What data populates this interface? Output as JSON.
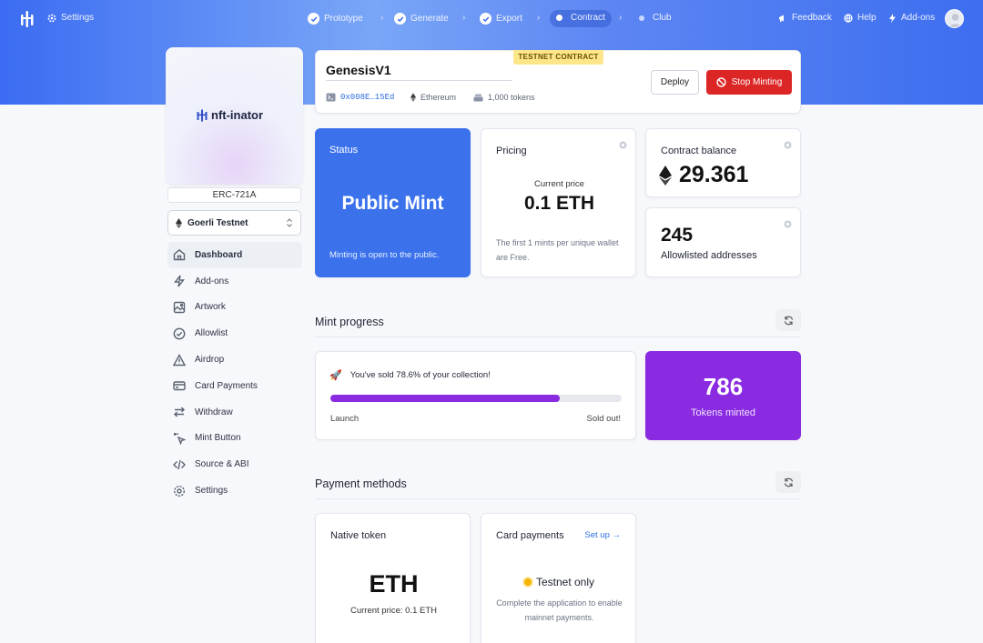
{
  "topbar": {
    "settings_label": "Settings",
    "steps": [
      {
        "label": "Prototype",
        "state": "done"
      },
      {
        "label": "Generate",
        "state": "done"
      },
      {
        "label": "Export",
        "state": "done"
      },
      {
        "label": "Contract",
        "state": "active"
      },
      {
        "label": "Club",
        "state": "pending"
      }
    ],
    "feedback_label": "Feedback",
    "help_label": "Help",
    "addons_label": "Add-ons"
  },
  "sidebar": {
    "brand": "nft-inator",
    "token_standard": "ERC-721A",
    "network": "Goerli Testnet",
    "items": [
      {
        "label": "Dashboard",
        "icon": "home-icon",
        "active": true
      },
      {
        "label": "Add-ons",
        "icon": "lightning-icon"
      },
      {
        "label": "Artwork",
        "icon": "image-icon"
      },
      {
        "label": "Allowlist",
        "icon": "check-circle-icon"
      },
      {
        "label": "Airdrop",
        "icon": "warning-triangle-icon"
      },
      {
        "label": "Card Payments",
        "icon": "credit-card-icon"
      },
      {
        "label": "Withdraw",
        "icon": "arrows-swap-icon"
      },
      {
        "label": "Mint Button",
        "icon": "cursor-click-icon"
      },
      {
        "label": "Source & ABI",
        "icon": "code-icon"
      },
      {
        "label": "Settings",
        "icon": "gear-icon"
      }
    ]
  },
  "contract": {
    "name": "GenesisV1",
    "badge": "TESTNET CONTRACT",
    "address": "0x008E…15Ed",
    "chain": "Ethereum",
    "supply": "1,000 tokens",
    "deploy_label": "Deploy",
    "stop_label": "Stop Minting"
  },
  "status": {
    "label": "Status",
    "value": "Public Mint",
    "note": "Minting is open to the public."
  },
  "pricing": {
    "label": "Pricing",
    "current_label": "Current price",
    "current_value": "0.1 ETH",
    "note": "The first 1 mints per unique wallet are Free."
  },
  "balance": {
    "label": "Contract balance",
    "value": "29.361"
  },
  "allowlist": {
    "count": "245",
    "label": "Allowlisted addresses"
  },
  "mint_progress": {
    "title": "Mint progress",
    "message": "You've sold 78.6% of your collection!",
    "percent": 78.6,
    "start_label": "Launch",
    "end_label": "Sold out!",
    "minted_count": "786",
    "minted_label": "Tokens minted"
  },
  "payment_methods": {
    "title": "Payment methods",
    "native": {
      "label": "Native token",
      "symbol": "ETH",
      "price_line": "Current price: 0.1 ETH"
    },
    "card": {
      "label": "Card payments",
      "setup_label": "Set up →",
      "status": "Testnet only",
      "note": "Complete the application to enable mainnet payments."
    }
  },
  "colors": {
    "accent_blue": "#3b72ec",
    "purple": "#8a2be2",
    "danger": "#dc2626",
    "badge_yellow": "#fde68a"
  }
}
